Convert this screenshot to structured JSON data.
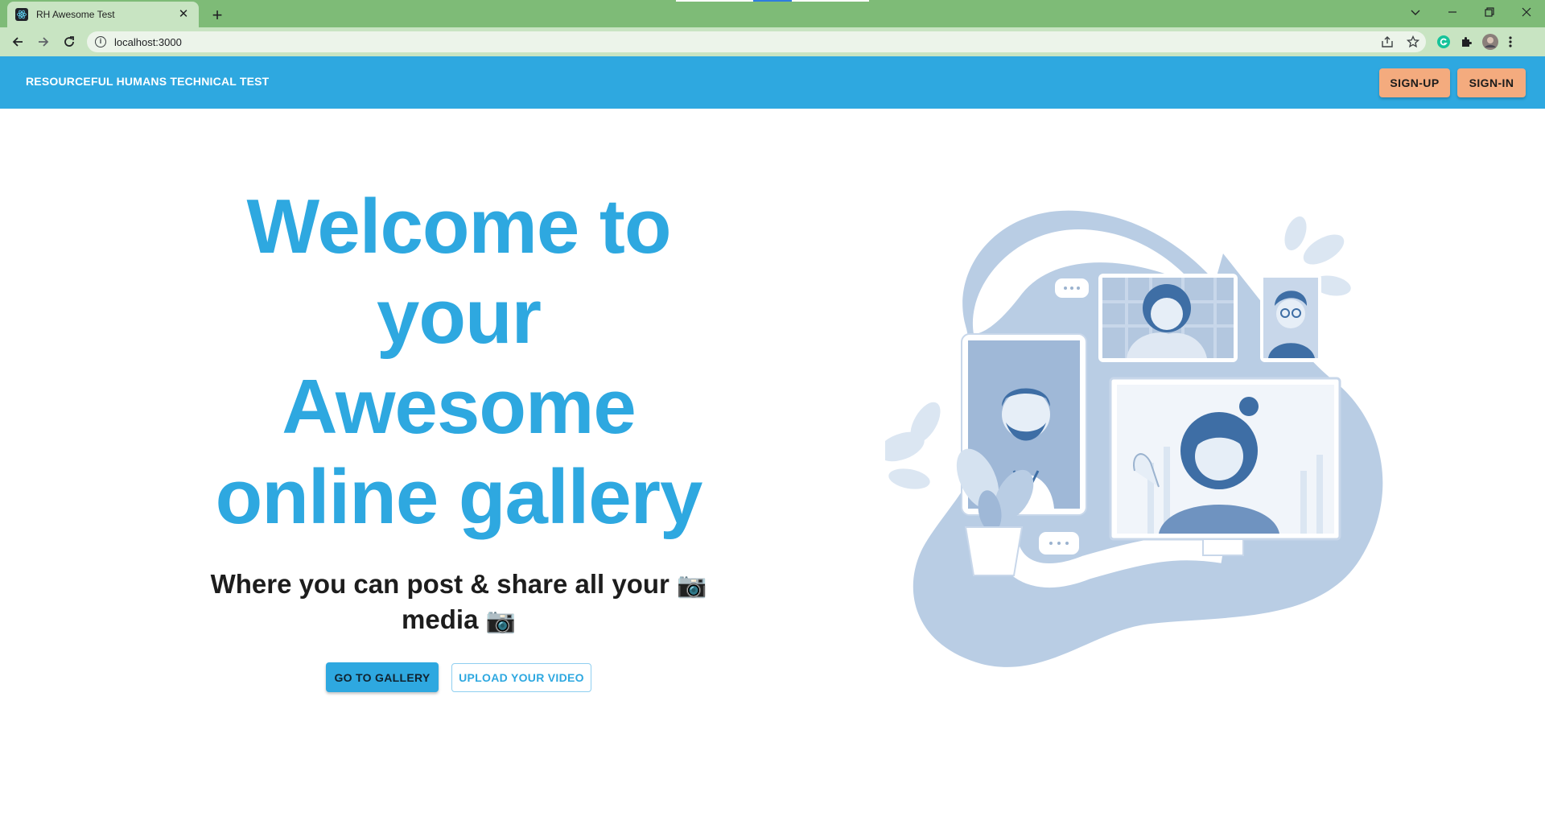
{
  "browser": {
    "tab_title": "RH Awesome Test",
    "url": "localhost:3000",
    "icons": [
      "react-favicon",
      "close-icon",
      "plus-icon",
      "back-icon",
      "forward-icon",
      "reload-icon",
      "info-icon",
      "share-icon",
      "star-icon",
      "grammarly-icon",
      "extensions-icon",
      "profile-avatar",
      "menu-icon",
      "chevron-down-icon",
      "minimize-icon",
      "restore-icon",
      "window-close-icon"
    ],
    "theme_color": "#7ebb77"
  },
  "appbar": {
    "title": "RESOURCEFUL HUMANS TECHNICAL TEST",
    "signup_label": "SIGN-UP",
    "signin_label": "SIGN-IN",
    "bg_color": "#2ea8e0",
    "button_color": "#f4ab7e"
  },
  "hero": {
    "title_lines": [
      "Welcome to",
      "your",
      "Awesome",
      "online gallery"
    ],
    "subtitle_line1": "Where you can post & share all your",
    "subtitle_line2": "media",
    "camera_emoji": "📷",
    "gallery_button": "GO TO GALLERY",
    "upload_button": "UPLOAD YOUR VIDEO",
    "accent_color": "#2ea8e0"
  }
}
